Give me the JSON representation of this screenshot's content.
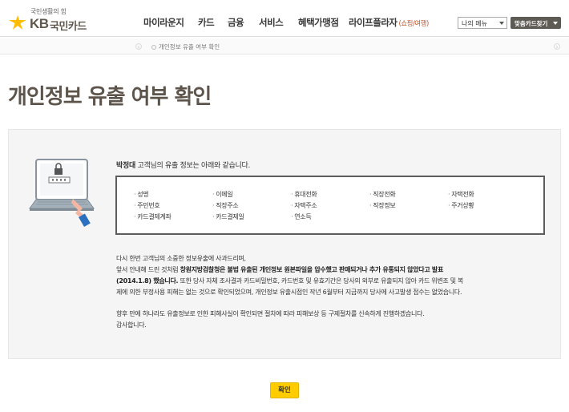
{
  "header": {
    "logo": {
      "tagline": "국민생활의 힘",
      "kb": "KB",
      "name": "국민카드"
    },
    "gnb": [
      {
        "label": "마이라운지"
      },
      {
        "label": "카드"
      },
      {
        "label": "금융"
      },
      {
        "label": "서비스"
      },
      {
        "label": "혜택가맹점"
      },
      {
        "label": "라이프플라자",
        "sub": "(쇼핑/여행)"
      }
    ],
    "my_menu": "나의 메뉴",
    "card_find": "맞춤카드찾기"
  },
  "breadcrumb": {
    "current": "개인정보 유출 여부 확인"
  },
  "page_title": "개인정보 유출 여부 확인",
  "panel": {
    "intro": {
      "name": "박정대",
      "suffix": " 고객님의 유출 정보는 아래와 같습니다."
    },
    "leaked_items": [
      [
        "성명",
        "이메일",
        "휴대전화",
        "직장전화",
        "자택전화"
      ],
      [
        "주민번호",
        "직장주소",
        "자택주소",
        "직장정보",
        "주거상황"
      ],
      [
        "카드결제계좌",
        "카드결제일",
        "연소득",
        "",
        ""
      ]
    ],
    "notice": {
      "line1": "다시 한번 고객님의 소중한 정보유출에 사과드리며,",
      "line2_a": "앞서 안내해 드린 것처럼 ",
      "line2_b": "창원지방검찰청은 불법 유출된 개인정보 원본파일을 압수했고 판매되거나 추가 유통되지 않았다고 발표",
      "line3_a": "(2014.1.8) 했습니다.",
      "line3_b": " 또한 당사 자체 조사결과 카드비밀번호, 카드번호 및 유효기간은 당사의 외부로 유출되지 않아 카드 위변조 및 복",
      "line4": "제에 의한 부정사용 피해는 없는 것으로 확인되었으며, 개인정보 유출시점인 작년 6월부터 지금까지 당사에 사고발생 접수는 없었습니다.",
      "line5": "향후 만에 하나라도 유출정보로 인한 피해사실이 확인되면 절차에 따라 피해보상 등 구제절차를 신속하게 진행하겠습니다.",
      "line6": "감사합니다."
    }
  },
  "confirm_label": "확인",
  "colors": {
    "brand_gold": "#ffbc00",
    "brand_brown": "#60584c",
    "confirm_yellow": "#ffcc00",
    "sub_menu_orange": "#c4542c"
  }
}
